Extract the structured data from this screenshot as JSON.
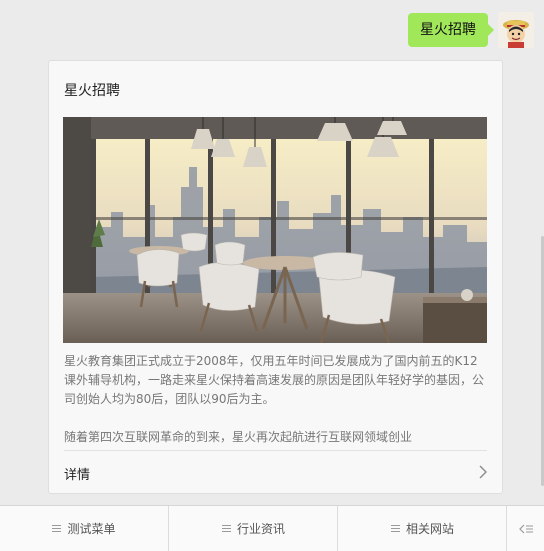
{
  "message": {
    "text": "星火招聘",
    "sender_avatar_icon": "avatar-icon"
  },
  "card": {
    "title": "星火招聘",
    "image_icon": "office-lounge-photo",
    "description": "星火教育集团正式成立于2008年，仅用五年时间已发展成为了国内前五的K12课外辅导机构，一路走来星火保持着高速发展的原因是团队年轻好学的基因，公司创始人均为80后，团队以90后为主。",
    "description_extra": "随着第四次互联网革命的到来，星火再次起航进行互联网领域创业",
    "detail_label": "详情",
    "detail_icon": "chevron-right-icon"
  },
  "menu": {
    "items": [
      {
        "label": "测试菜单",
        "icon": "menu-lines-icon"
      },
      {
        "label": "行业资讯",
        "icon": "menu-lines-icon"
      },
      {
        "label": "相关网站",
        "icon": "menu-lines-icon"
      }
    ],
    "keyboard_icon": "keyboard-toggle-icon"
  },
  "colors": {
    "bubble": "#a0e75a",
    "background": "#ebebeb",
    "card": "#f8f8f8"
  }
}
